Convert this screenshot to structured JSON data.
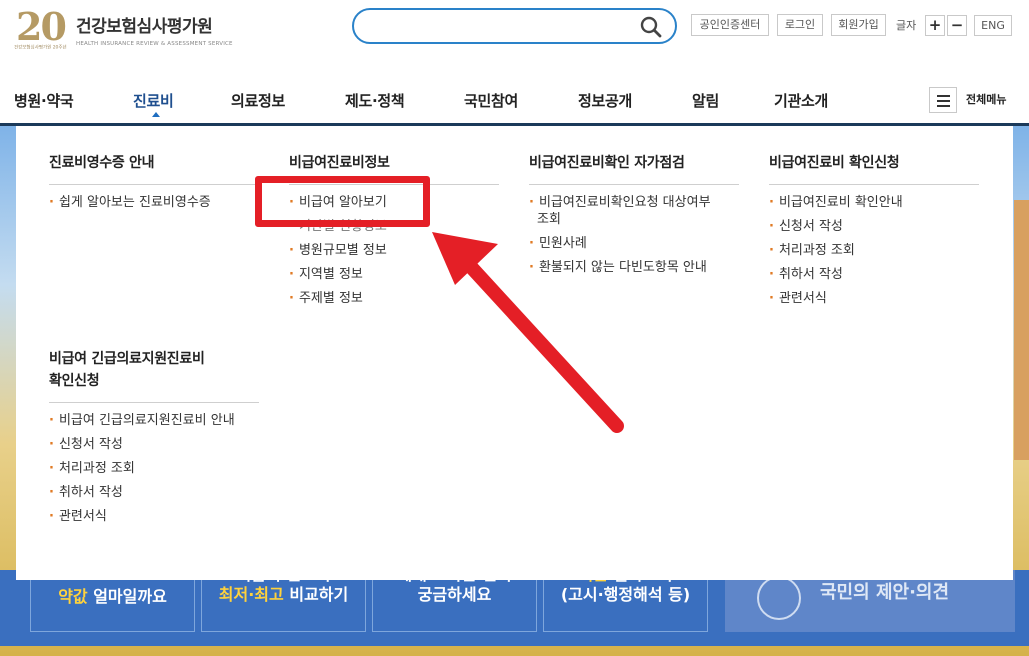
{
  "header": {
    "logo_number": "20",
    "logo_name": "건강보험심사평가원",
    "logo_english": "HEALTH INSURANCE REVIEW & ASSESSMENT SERVICE",
    "logo_sub": "건강보험심사평가원 20주년",
    "search": {
      "value": "",
      "placeholder": ""
    },
    "util": {
      "cert_label": "공인인증센터",
      "login_label": "로그인",
      "join_label": "회원가입",
      "font_label": "글자",
      "font_plus": "+",
      "font_minus": "−",
      "eng_label": "ENG"
    }
  },
  "gnb": {
    "items": [
      {
        "label": "병원·약국"
      },
      {
        "label": "진료비"
      },
      {
        "label": "의료정보"
      },
      {
        "label": "제도·정책"
      },
      {
        "label": "국민참여"
      },
      {
        "label": "정보공개"
      },
      {
        "label": "알림"
      },
      {
        "label": "기관소개"
      }
    ],
    "allmenu_label": "전체메뉴"
  },
  "mega_menu": {
    "col1": {
      "title": "진료비영수증 안내",
      "items": [
        "쉽게 알아보는 진료비영수증"
      ]
    },
    "col2": {
      "title": "비급여진료비정보",
      "items": [
        "비급여 알아보기",
        "기관별 현황정보",
        "병원규모별 정보",
        "지역별 정보",
        "주제별 정보"
      ]
    },
    "col3": {
      "title": "비급여진료비확인 자가점검",
      "items": [
        "비급여진료비확인요청 대상여부",
        "조회",
        "민원사례",
        "환불되지 않는 다빈도항목 안내"
      ]
    },
    "col4": {
      "title": "비급여진료비 확인신청",
      "items": [
        "비급여진료비 확인안내",
        "신청서 작성",
        "처리과정 조회",
        "취하서 작성",
        "관련서식"
      ]
    },
    "col5": {
      "title_line1": "비급여 긴급의료지원진료비",
      "title_line2": "확인신청",
      "items": [
        "비급여 긴급의료지원진료비 안내",
        "신청서 작성",
        "처리과정 조회",
        "취하서 작성",
        "관련서식"
      ]
    }
  },
  "banners": {
    "b1": {
      "hl": "약값",
      "text": " 얼마일까요"
    },
    "b2": {
      "line1": "비급여 진료비",
      "hl": "최저·최고",
      "text": " 비교하기"
    },
    "b3": {
      "line1": "제대로 나온 진지",
      "line2": "궁금하세요"
    },
    "b4": {
      "hl": "기준",
      "text": " 알아보기",
      "line2": "(고시·행정해석 등)"
    },
    "b5": {
      "text": "국민의 제안·의견"
    }
  },
  "annotation": {
    "color": "#e41f26"
  }
}
